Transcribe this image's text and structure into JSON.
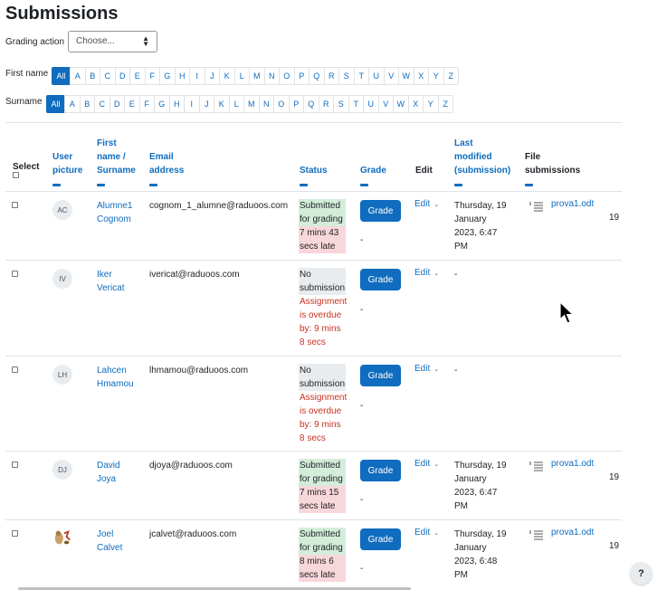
{
  "page": {
    "title": "Submissions"
  },
  "grading_action": {
    "label": "Grading action",
    "selected": "Choose..."
  },
  "initials": {
    "firstname_label": "First name",
    "surname_label": "Surname",
    "letters": [
      "All",
      "A",
      "B",
      "C",
      "D",
      "E",
      "F",
      "G",
      "H",
      "I",
      "J",
      "K",
      "L",
      "M",
      "N",
      "O",
      "P",
      "Q",
      "R",
      "S",
      "T",
      "U",
      "V",
      "W",
      "X",
      "Y",
      "Z"
    ]
  },
  "columns": {
    "select": "Select",
    "user_picture": [
      "User",
      "picture"
    ],
    "name": [
      "First",
      "name /",
      "Surname"
    ],
    "email": "Email address",
    "status": "Status",
    "grade": "Grade",
    "edit": "Edit",
    "last_modified": [
      "Last",
      "modified",
      "(submission)"
    ],
    "file_submissions": "File submissions"
  },
  "rows": [
    {
      "initials": "AC",
      "name": [
        "Alumne1",
        "Cognom"
      ],
      "email": "cognom_1_alumne@raduoos.com",
      "status": [
        "Submitted",
        "for grading"
      ],
      "status_type": "submitted",
      "extra": [
        "7 mins 43",
        "secs late"
      ],
      "extra_type": "late",
      "grade_button": "Grade",
      "grade_value": "-",
      "edit": "Edit",
      "modified": [
        "Thursday, 19",
        "January",
        "2023, 6:47",
        "PM"
      ],
      "file": "prova1.odt",
      "overflow": "19"
    },
    {
      "initials": "IV",
      "name": [
        "Iker",
        "Vericat"
      ],
      "email": "ivericat@raduoos.com",
      "status": [
        "No",
        "submission"
      ],
      "status_type": "none",
      "extra": [
        "Assignment",
        "is overdue",
        "by: 9 mins",
        "8 secs"
      ],
      "extra_type": "overdue",
      "grade_button": "Grade",
      "grade_value": "-",
      "edit": "Edit",
      "modified": [
        "-"
      ],
      "file": "",
      "overflow": ""
    },
    {
      "initials": "LH",
      "name": [
        "Lahcen",
        "Hmamou"
      ],
      "email": "lhmamou@raduoos.com",
      "status": [
        "No",
        "submission"
      ],
      "status_type": "none",
      "extra": [
        "Assignment",
        "is overdue",
        "by: 9 mins",
        "8 secs"
      ],
      "extra_type": "overdue",
      "grade_button": "Grade",
      "grade_value": "-",
      "edit": "Edit",
      "modified": [
        "-"
      ],
      "file": "",
      "overflow": ""
    },
    {
      "initials": "DJ",
      "name": [
        "David",
        "Joya"
      ],
      "email": "djoya@raduoos.com",
      "status": [
        "Submitted",
        "for grading"
      ],
      "status_type": "submitted",
      "extra": [
        "7 mins 15",
        "secs late"
      ],
      "extra_type": "late",
      "grade_button": "Grade",
      "grade_value": "-",
      "edit": "Edit",
      "modified": [
        "Thursday, 19",
        "January",
        "2023, 6:47",
        "PM"
      ],
      "file": "prova1.odt",
      "overflow": "19"
    },
    {
      "initials": "",
      "name": [
        "Joel",
        "Calvet"
      ],
      "email": "jcalvet@raduoos.com",
      "status": [
        "Submitted",
        "for grading"
      ],
      "status_type": "submitted",
      "extra": [
        "8 mins 6",
        "secs late"
      ],
      "extra_type": "late",
      "grade_button": "Grade",
      "grade_value": "-",
      "edit": "Edit",
      "modified": [
        "Thursday, 19",
        "January",
        "2023, 6:48",
        "PM"
      ],
      "file": "prova1.odt",
      "overflow": "19"
    }
  ],
  "help": {
    "label": "?"
  },
  "icons": {
    "select_caret": "chevron-updown-icon",
    "edit_caret": "chevron-down-icon",
    "file": "document-lines-icon",
    "cursor": "mouse-pointer-icon"
  },
  "colors": {
    "link": "#0f6cbf",
    "submitted_bg": "#d4edda",
    "late_bg": "#f8d7da",
    "overdue_text": "#ca3120",
    "none_bg": "#e9ecef"
  }
}
